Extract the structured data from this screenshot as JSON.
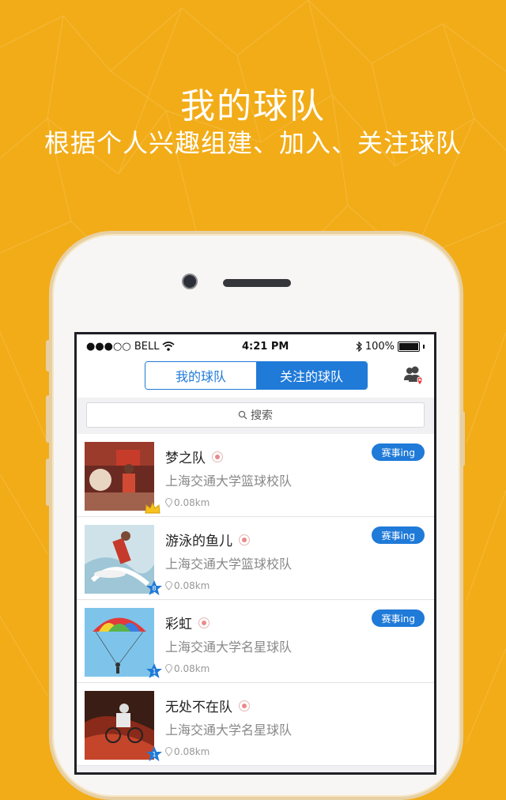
{
  "promo": {
    "title": "我的球队",
    "subtitle": "根据个人兴趣组建、加入、关注球队"
  },
  "statusbar": {
    "carrier": "●●●○○ BELL",
    "time": "4:21 PM",
    "battery": "100%"
  },
  "header": {
    "tab_my": "我的球队",
    "tab_follow": "关注的球队",
    "selected_tab": "关注的球队",
    "right_icon": "team-location-icon"
  },
  "search": {
    "label": "搜索",
    "icon": "search-icon"
  },
  "teams": [
    {
      "name": "梦之队",
      "school": "上海交通大学篮球校队",
      "distance": "0.08km",
      "status": "赛事ing",
      "badge": "crown",
      "badge_text": ""
    },
    {
      "name": "游泳的鱼儿",
      "school": "上海交通大学篮球校队",
      "distance": "0.08km",
      "status": "赛事ing",
      "badge": "star",
      "badge_text": "8"
    },
    {
      "name": "彩虹",
      "school": "上海交通大学名星球队",
      "distance": "0.08km",
      "status": "赛事ing",
      "badge": "star",
      "badge_text": "1"
    },
    {
      "name": "无处不在队",
      "school": "上海交通大学名星球队",
      "distance": "0.08km",
      "status": "",
      "badge": "star",
      "badge_text": "1"
    }
  ],
  "colors": {
    "background": "#f2ac18",
    "accent": "#1f7ad8"
  }
}
